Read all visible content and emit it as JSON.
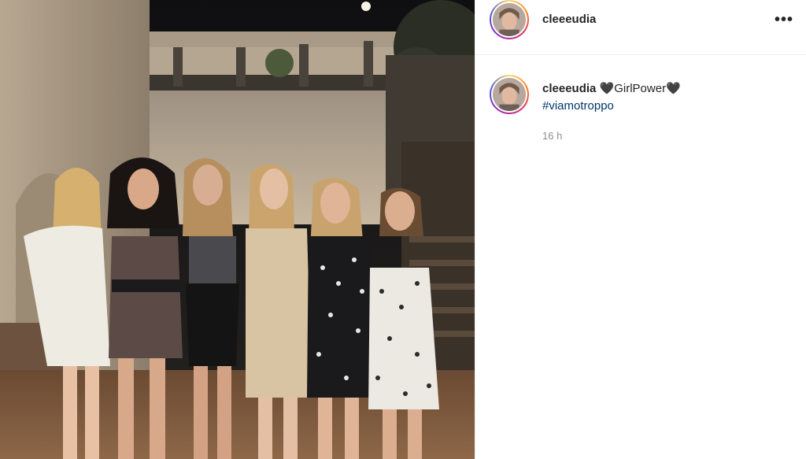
{
  "post": {
    "username": "cleeeudia",
    "more_label": "•••"
  },
  "caption": {
    "username": "cleeeudia",
    "text": "🖤GirlPower🖤",
    "hashtag": "#viamotroppo",
    "time": "16 h"
  },
  "icons": {
    "more": "more-options-icon",
    "avatar": "profile-avatar-icon"
  },
  "colors": {
    "hashtag": "#00376b",
    "muted": "#8e8e8e",
    "divider": "#efefef"
  }
}
